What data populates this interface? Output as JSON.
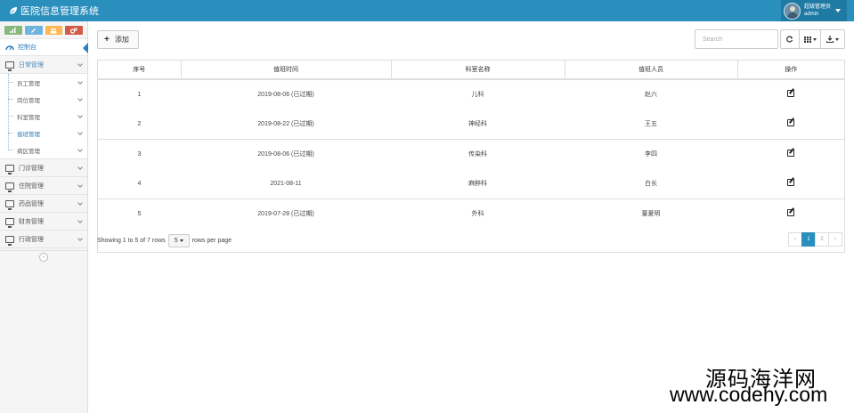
{
  "app": {
    "title": "医院信息管理系统"
  },
  "user": {
    "name": "超级管理员",
    "role": "admin"
  },
  "sidebar": {
    "shortcut_icons": [
      "signal-icon",
      "pencil-icon",
      "users-icon",
      "cogs-icon"
    ],
    "dashboard_label": "控制台",
    "menus": [
      {
        "label": "日常管理",
        "open": true
      },
      {
        "label": "门诊管理"
      },
      {
        "label": "住院管理"
      },
      {
        "label": "药品管理"
      },
      {
        "label": "财务管理"
      },
      {
        "label": "行政管理"
      }
    ],
    "submenu": [
      {
        "label": "员工管理"
      },
      {
        "label": "岗位管理"
      },
      {
        "label": "科室管理"
      },
      {
        "label": "值班管理",
        "active": true
      },
      {
        "label": "病区管理"
      }
    ]
  },
  "toolbar": {
    "add_label": "添加",
    "search_placeholder": "Search"
  },
  "table": {
    "headers": [
      "序号",
      "值班时间",
      "科室名称",
      "值班人员",
      "操作"
    ],
    "rows": [
      [
        "1",
        "2019-08-06 (已过期)",
        "儿科",
        "赵六"
      ],
      [
        "2",
        "2019-08-22 (已过期)",
        "神经科",
        "王五"
      ],
      [
        "3",
        "2019-08-06 (已过期)",
        "传染科",
        "李四"
      ],
      [
        "4",
        "2021-08-11",
        "麻醉科",
        "白长"
      ],
      [
        "5",
        "2019-07-28 (已过期)",
        "外科",
        "董夏明"
      ]
    ]
  },
  "footer": {
    "showing": "Showing 1 to 5 of 7 rows",
    "page_size": "5",
    "per_page": "rows per page"
  },
  "pagination": {
    "prev": "‹",
    "pages": [
      "1",
      "2"
    ],
    "next": "›",
    "current": 1
  },
  "watermark": {
    "line1": "源码海洋网",
    "line2": "www.codehy.com"
  },
  "colors": {
    "navbar": "#2a8fbd",
    "active_page": "#2a8fbd",
    "link": "#2b7dbc"
  }
}
